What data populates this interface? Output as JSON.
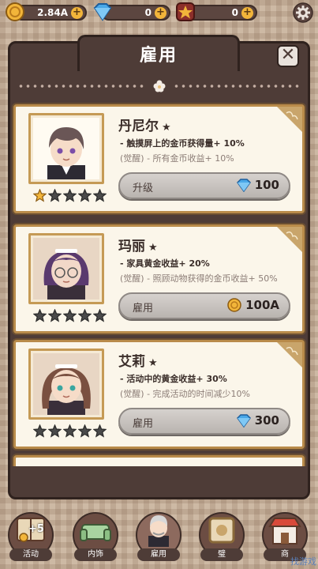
{
  "currency": {
    "gold": "2.84A",
    "gems": "0",
    "stars": "0"
  },
  "header": {
    "title": "雇用",
    "close_icon": "close-icon"
  },
  "cards": [
    {
      "name": "丹尼尔",
      "rank": "★",
      "desc1": "- 触摸屏上的金币获得量+ 10%",
      "desc2": "(觉醒) - 所有金币收益+ 10%",
      "action": "升级",
      "price": "100",
      "price_icon": "gem-icon",
      "stars_filled": 1,
      "stars_total": 5
    },
    {
      "name": "玛丽",
      "rank": "★",
      "desc1": "- 家具黄金收益+ 20%",
      "desc2": "(觉醒) - 照顾动物获得的金币收益+ 50%",
      "action": "雇用",
      "price": "100A",
      "price_icon": "coin-icon",
      "stars_filled": 0,
      "stars_total": 5
    },
    {
      "name": "艾莉",
      "rank": "★",
      "desc1": "- 活动中的黄金收益+ 30%",
      "desc2": "(觉醒) - 完成活动的时间减少10%",
      "action": "雇用",
      "price": "300",
      "price_icon": "gem-icon",
      "stars_filled": 0,
      "stars_total": 5
    }
  ],
  "nav": [
    {
      "label": "活动",
      "badge": "+5",
      "icon": "book-icon"
    },
    {
      "label": "内饰",
      "badge": "",
      "icon": "sofa-icon"
    },
    {
      "label": "雇用",
      "badge": "",
      "icon": "butler-icon"
    },
    {
      "label": "璧",
      "badge": "",
      "icon": "frame-icon"
    },
    {
      "label": "商",
      "badge": "",
      "icon": "shop-icon"
    }
  ],
  "colors": {
    "panel": "#4e3c37",
    "card_border": "#b98b4a",
    "gold": "#f2b53a",
    "gem": "#4aa8e8"
  },
  "watermark": "找游戏"
}
